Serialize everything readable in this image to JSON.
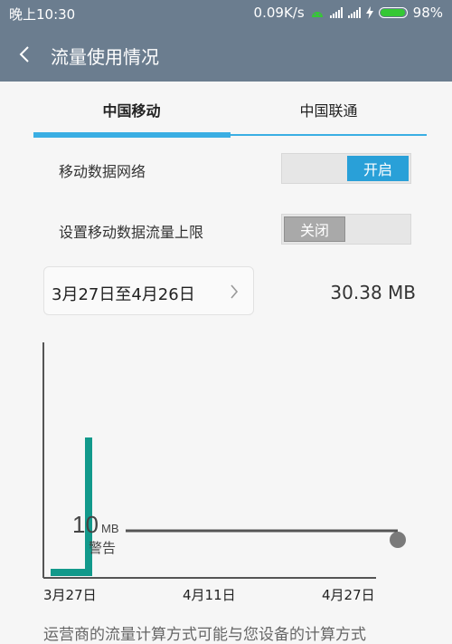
{
  "status_bar": {
    "time": "晚上10:30",
    "net_speed": "0.09K/s",
    "battery_percent": "98%",
    "battery_level": 0.98
  },
  "app_bar": {
    "title": "流量使用情况"
  },
  "tabs": [
    {
      "label": "中国移动",
      "active": true
    },
    {
      "label": "中国联通",
      "active": false
    }
  ],
  "mobile_data": {
    "label": "移动数据网络",
    "state_label": "开启"
  },
  "data_limit": {
    "label": "设置移动数据流量上限",
    "state_label": "关闭"
  },
  "date_range": {
    "text": "3月27日至4月26日"
  },
  "usage_total": "30.38 MB",
  "chart_data": {
    "type": "area",
    "x_labels": [
      "3月27日",
      "4月11日",
      "4月27日"
    ],
    "warning": {
      "value": "10",
      "unit": "MB",
      "label": "警告"
    },
    "colors": {
      "usage": "#12998b",
      "warning_line": "#555555",
      "axis": "#555555"
    }
  },
  "footer_note": "运营商的流量计算方式可能与您设备的计算方式"
}
